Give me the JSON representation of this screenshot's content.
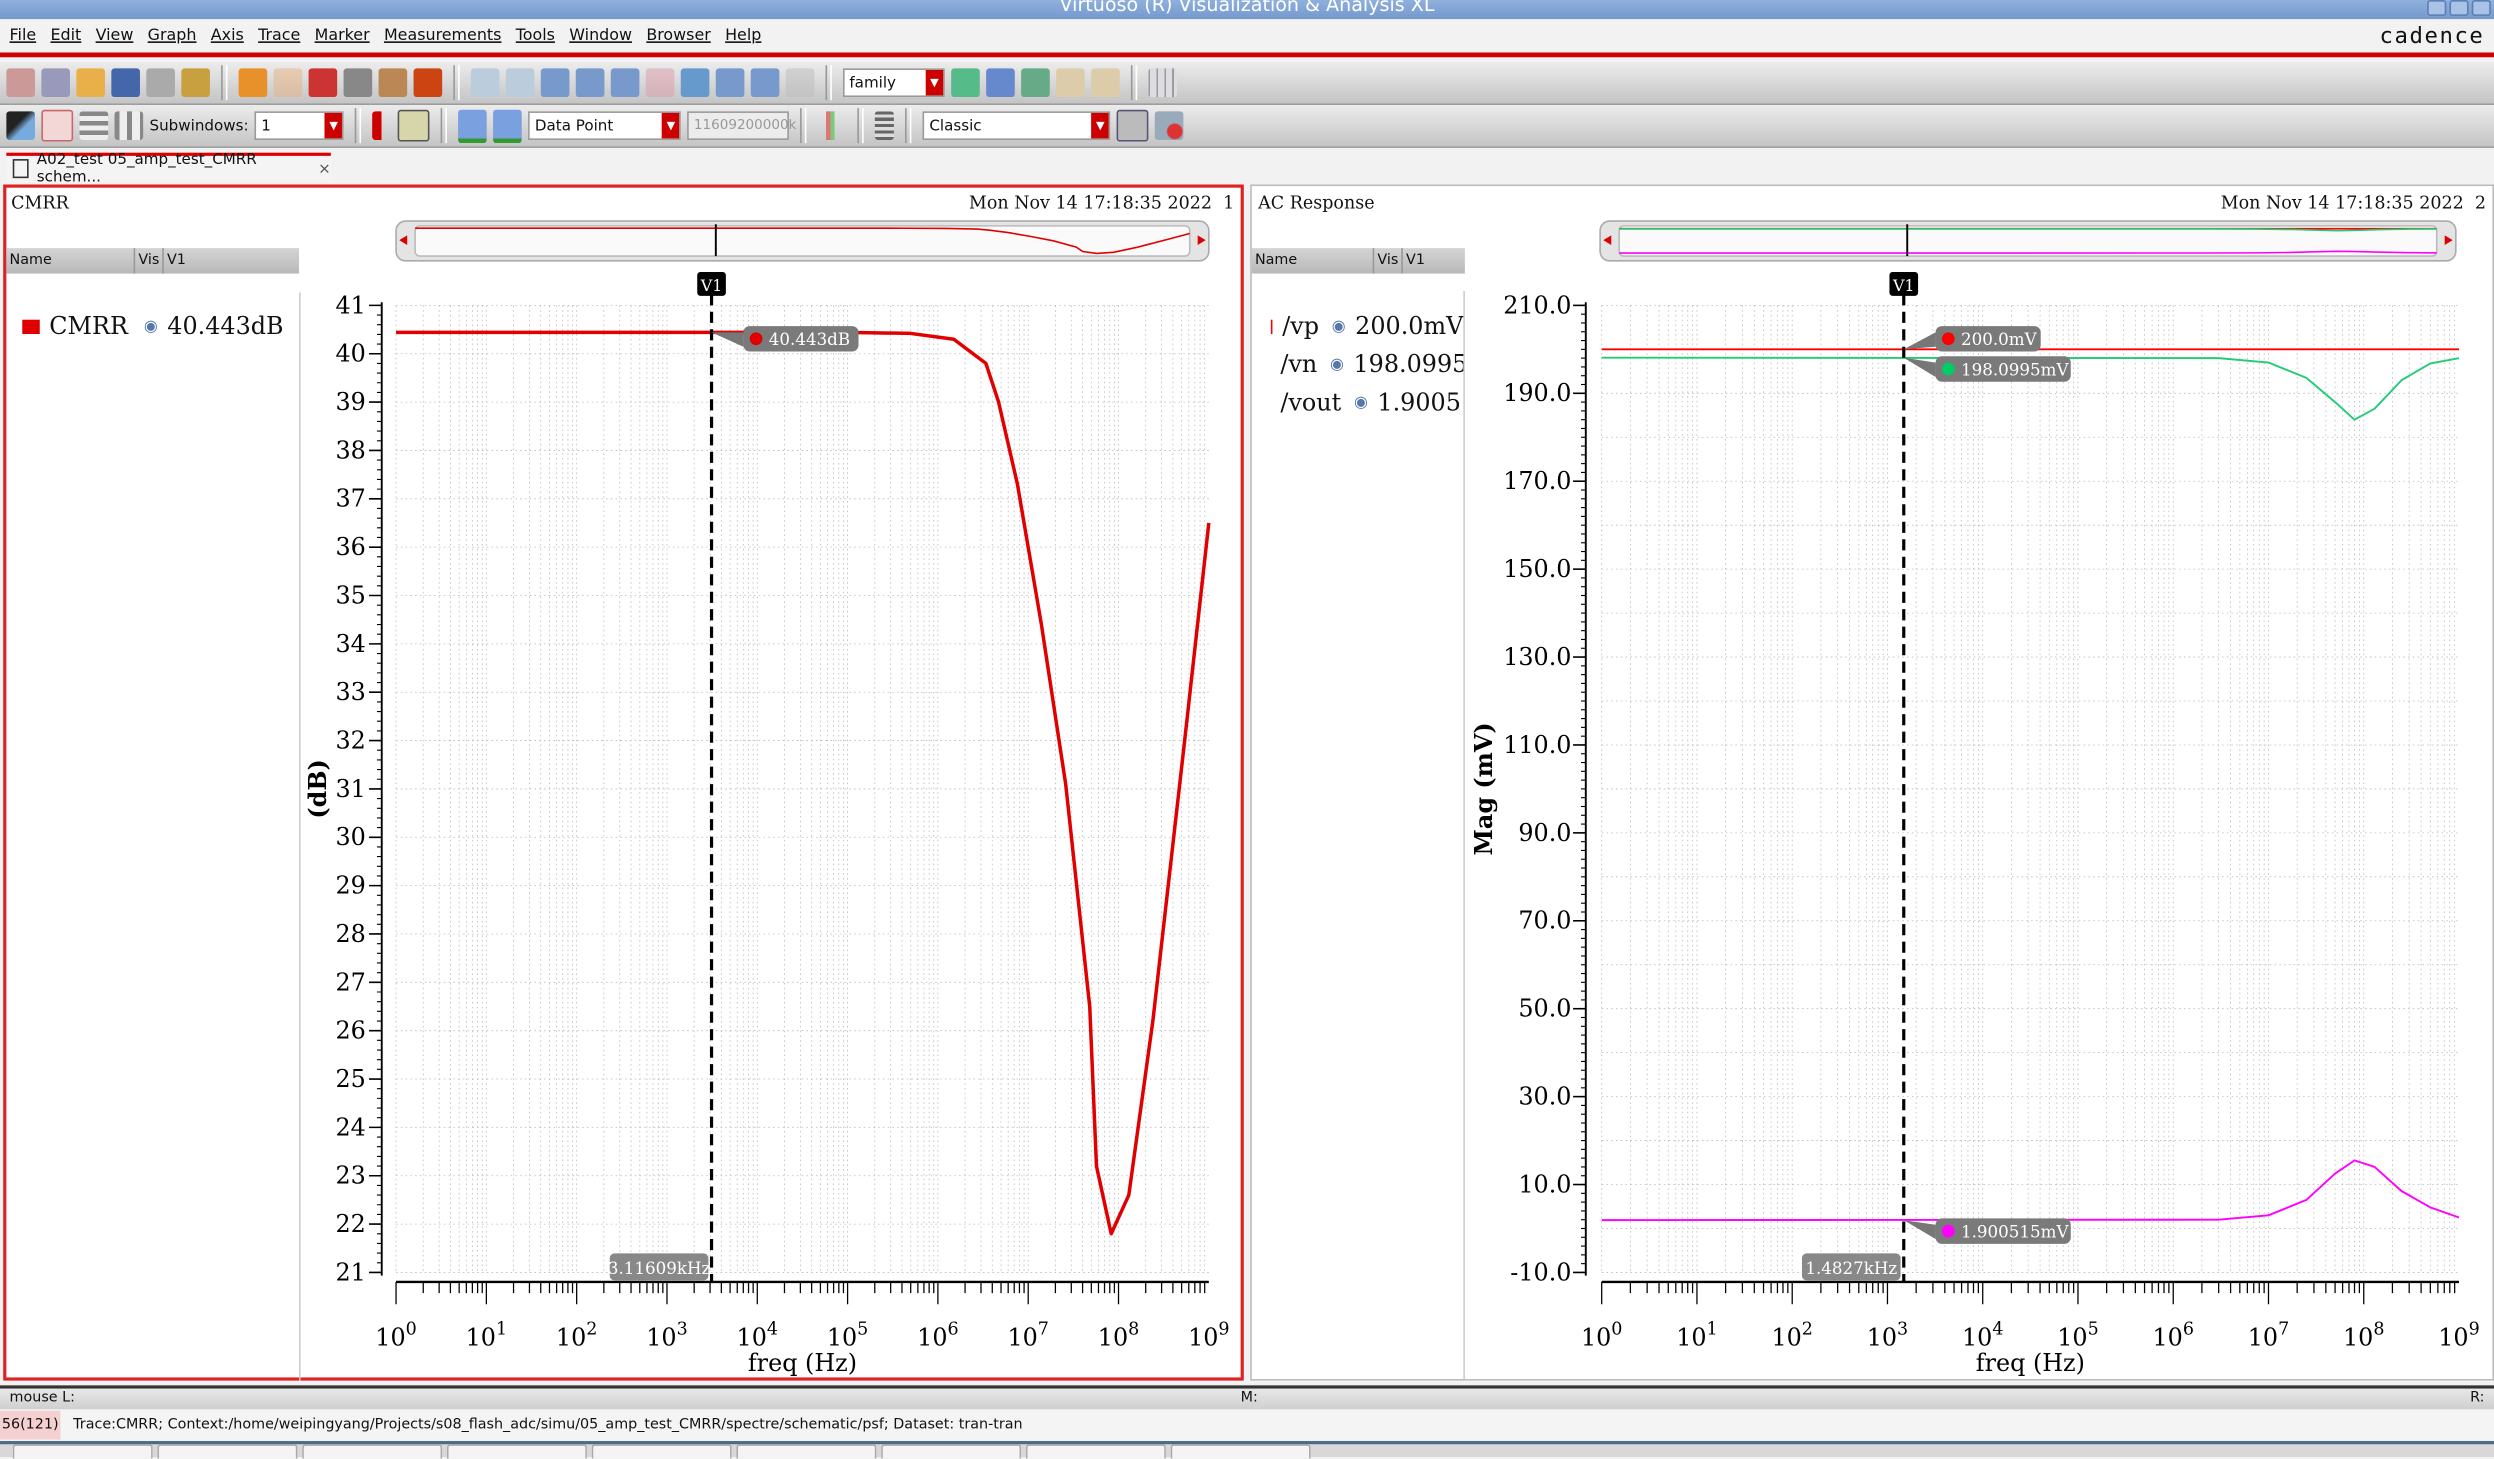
{
  "window": {
    "title": "Virtuoso (R) Visualization & Analysis XL",
    "logo": "cadence"
  },
  "menu": [
    "File",
    "Edit",
    "View",
    "Graph",
    "Axis",
    "Trace",
    "Marker",
    "Measurements",
    "Tools",
    "Window",
    "Browser",
    "Help"
  ],
  "toolbar": {
    "family_combo": "family",
    "subwindows_label": "Subwindows:",
    "subwindows_value": "1",
    "marker_type_combo": "Data Point",
    "marker_value_field": "11609200000k",
    "style_combo": "Classic",
    "icons1": [
      "new-window-icon",
      "new-subwindow-icon",
      "open-icon",
      "save-icon",
      "print-icon",
      "plot-icon",
      "undo-icon",
      "redo-icon",
      "cut-icon",
      "copy-icon",
      "paste-icon",
      "delete-icon",
      "back-icon",
      "forward-icon",
      "zoom-fit-icon",
      "zoom-in-icon",
      "zoom-out-icon",
      "zoom-x-icon",
      "zoom-box-icon",
      "zoom-y-icon",
      "zoom-xy-icon",
      "zoom-reset-icon"
    ],
    "icons_after_family": [
      "strip-icon",
      "overlay-icon",
      "stack-icon",
      "link-icon",
      "unlink-icon"
    ],
    "grid_icon": "grid-icon"
  },
  "tab": {
    "label": "A02_test 05_amp_test_CMRR schem...",
    "close": "×"
  },
  "legend_header": {
    "name": "Name",
    "vis": "Vis",
    "v1": "V1"
  },
  "panels": [
    {
      "title": "CMRR",
      "timestamp": "Mon Nov 14 17:18:35 2022",
      "index": "1",
      "legend": [
        {
          "name": "CMRR",
          "value": "40.443dB",
          "color": "#e00000"
        }
      ]
    },
    {
      "title": "AC Response",
      "timestamp": "Mon Nov 14 17:18:35 2022",
      "index": "2",
      "legend": [
        {
          "name": "/vp",
          "value": "200.0mV",
          "color": "#ff0000"
        },
        {
          "name": "/vn",
          "value": "198.0995mV",
          "color": "#00cc66"
        },
        {
          "name": "/vout",
          "value": "1.900515mV",
          "color": "#ff00ff"
        }
      ]
    }
  ],
  "chart_data": [
    {
      "type": "line",
      "xlabel": "freq (Hz)",
      "ylabel": "(dB)",
      "xscale": "log",
      "xlim": [
        1,
        1000000000
      ],
      "xticks": [
        "0",
        "1",
        "2",
        "3",
        "4",
        "5",
        "6",
        "7",
        "8",
        "9"
      ],
      "xtick_base": "10",
      "ylim": [
        21,
        41
      ],
      "yticks": [
        41,
        40,
        39,
        38,
        37,
        36,
        35,
        34,
        33,
        32,
        31,
        30,
        29,
        28,
        27,
        26,
        25,
        24,
        23,
        22,
        21
      ],
      "ytick_format": "int",
      "grid": true,
      "series": [
        {
          "name": "CMRR",
          "color": "#e00000",
          "x": [
            1,
            100000,
            500000,
            1500000,
            3400000,
            4700000,
            7600000,
            14000000,
            26000000,
            48000000,
            57000000,
            83000000,
            130000000,
            240000000,
            540000000,
            1000000000
          ],
          "y": [
            40.443,
            40.443,
            40.42,
            40.3,
            39.8,
            39.0,
            37.3,
            34.4,
            31.1,
            26.5,
            23.2,
            21.8,
            22.6,
            26.2,
            32.0,
            36.5
          ]
        }
      ],
      "marker": {
        "label": "V1",
        "x_label": "3.11609kHz",
        "x": 3116.09,
        "values": [
          {
            "text": "40.443dB",
            "y": 40.443,
            "color": "#e00000"
          }
        ]
      }
    },
    {
      "type": "line",
      "xlabel": "freq (Hz)",
      "ylabel": "Mag (mV)",
      "xscale": "log",
      "xlim": [
        1,
        1000000000
      ],
      "xticks": [
        "0",
        "1",
        "2",
        "3",
        "4",
        "5",
        "6",
        "7",
        "8",
        "9"
      ],
      "xtick_base": "10",
      "ylim": [
        -10,
        210
      ],
      "yticks": [
        210,
        190,
        170,
        150,
        130,
        110,
        90,
        70,
        50,
        30,
        10,
        -10
      ],
      "ytick_format": "1dp",
      "grid": true,
      "series": [
        {
          "name": "/vp",
          "color": "#ff0000",
          "x": [
            1,
            1000000000
          ],
          "y": [
            200.0,
            200.0
          ]
        },
        {
          "name": "/vn",
          "color": "#22cc77",
          "x": [
            1,
            3000000,
            10000000,
            25000000,
            50000000,
            80000000,
            130000000,
            250000000,
            500000000,
            1000000000
          ],
          "y": [
            198.1,
            198.0,
            197.0,
            193.5,
            188.0,
            184.0,
            186.5,
            193.0,
            196.8,
            198.0
          ]
        },
        {
          "name": "/vout",
          "color": "#ff00ff",
          "x": [
            1,
            3000000,
            10000000,
            25000000,
            50000000,
            80000000,
            130000000,
            250000000,
            500000000,
            1000000000
          ],
          "y": [
            1.9,
            2.0,
            3.0,
            6.5,
            12.5,
            15.5,
            14.0,
            8.5,
            4.8,
            2.5
          ]
        }
      ],
      "marker": {
        "label": "V1",
        "x_label": "1.4827kHz",
        "x": 1482.7,
        "values": [
          {
            "text": "200.0mV",
            "y": 200.0,
            "color": "#ff0000"
          },
          {
            "text": "198.0995mV",
            "y": 198.0995,
            "color": "#00cc66"
          },
          {
            "text": "1.900515mV",
            "y": 1.900515,
            "color": "#ff00ff"
          }
        ]
      }
    }
  ],
  "status": {
    "mouse_l": "mouse L:",
    "mouse_m": "M:",
    "mouse_r": "R:",
    "line_no": "56(121)",
    "message": "Trace:CMRR; Context:/home/weipingyang/Projects/s08_flash_adc/simu/05_amp_test_CMRR/spectre/schematic/psf; Dataset: tran-tran"
  }
}
